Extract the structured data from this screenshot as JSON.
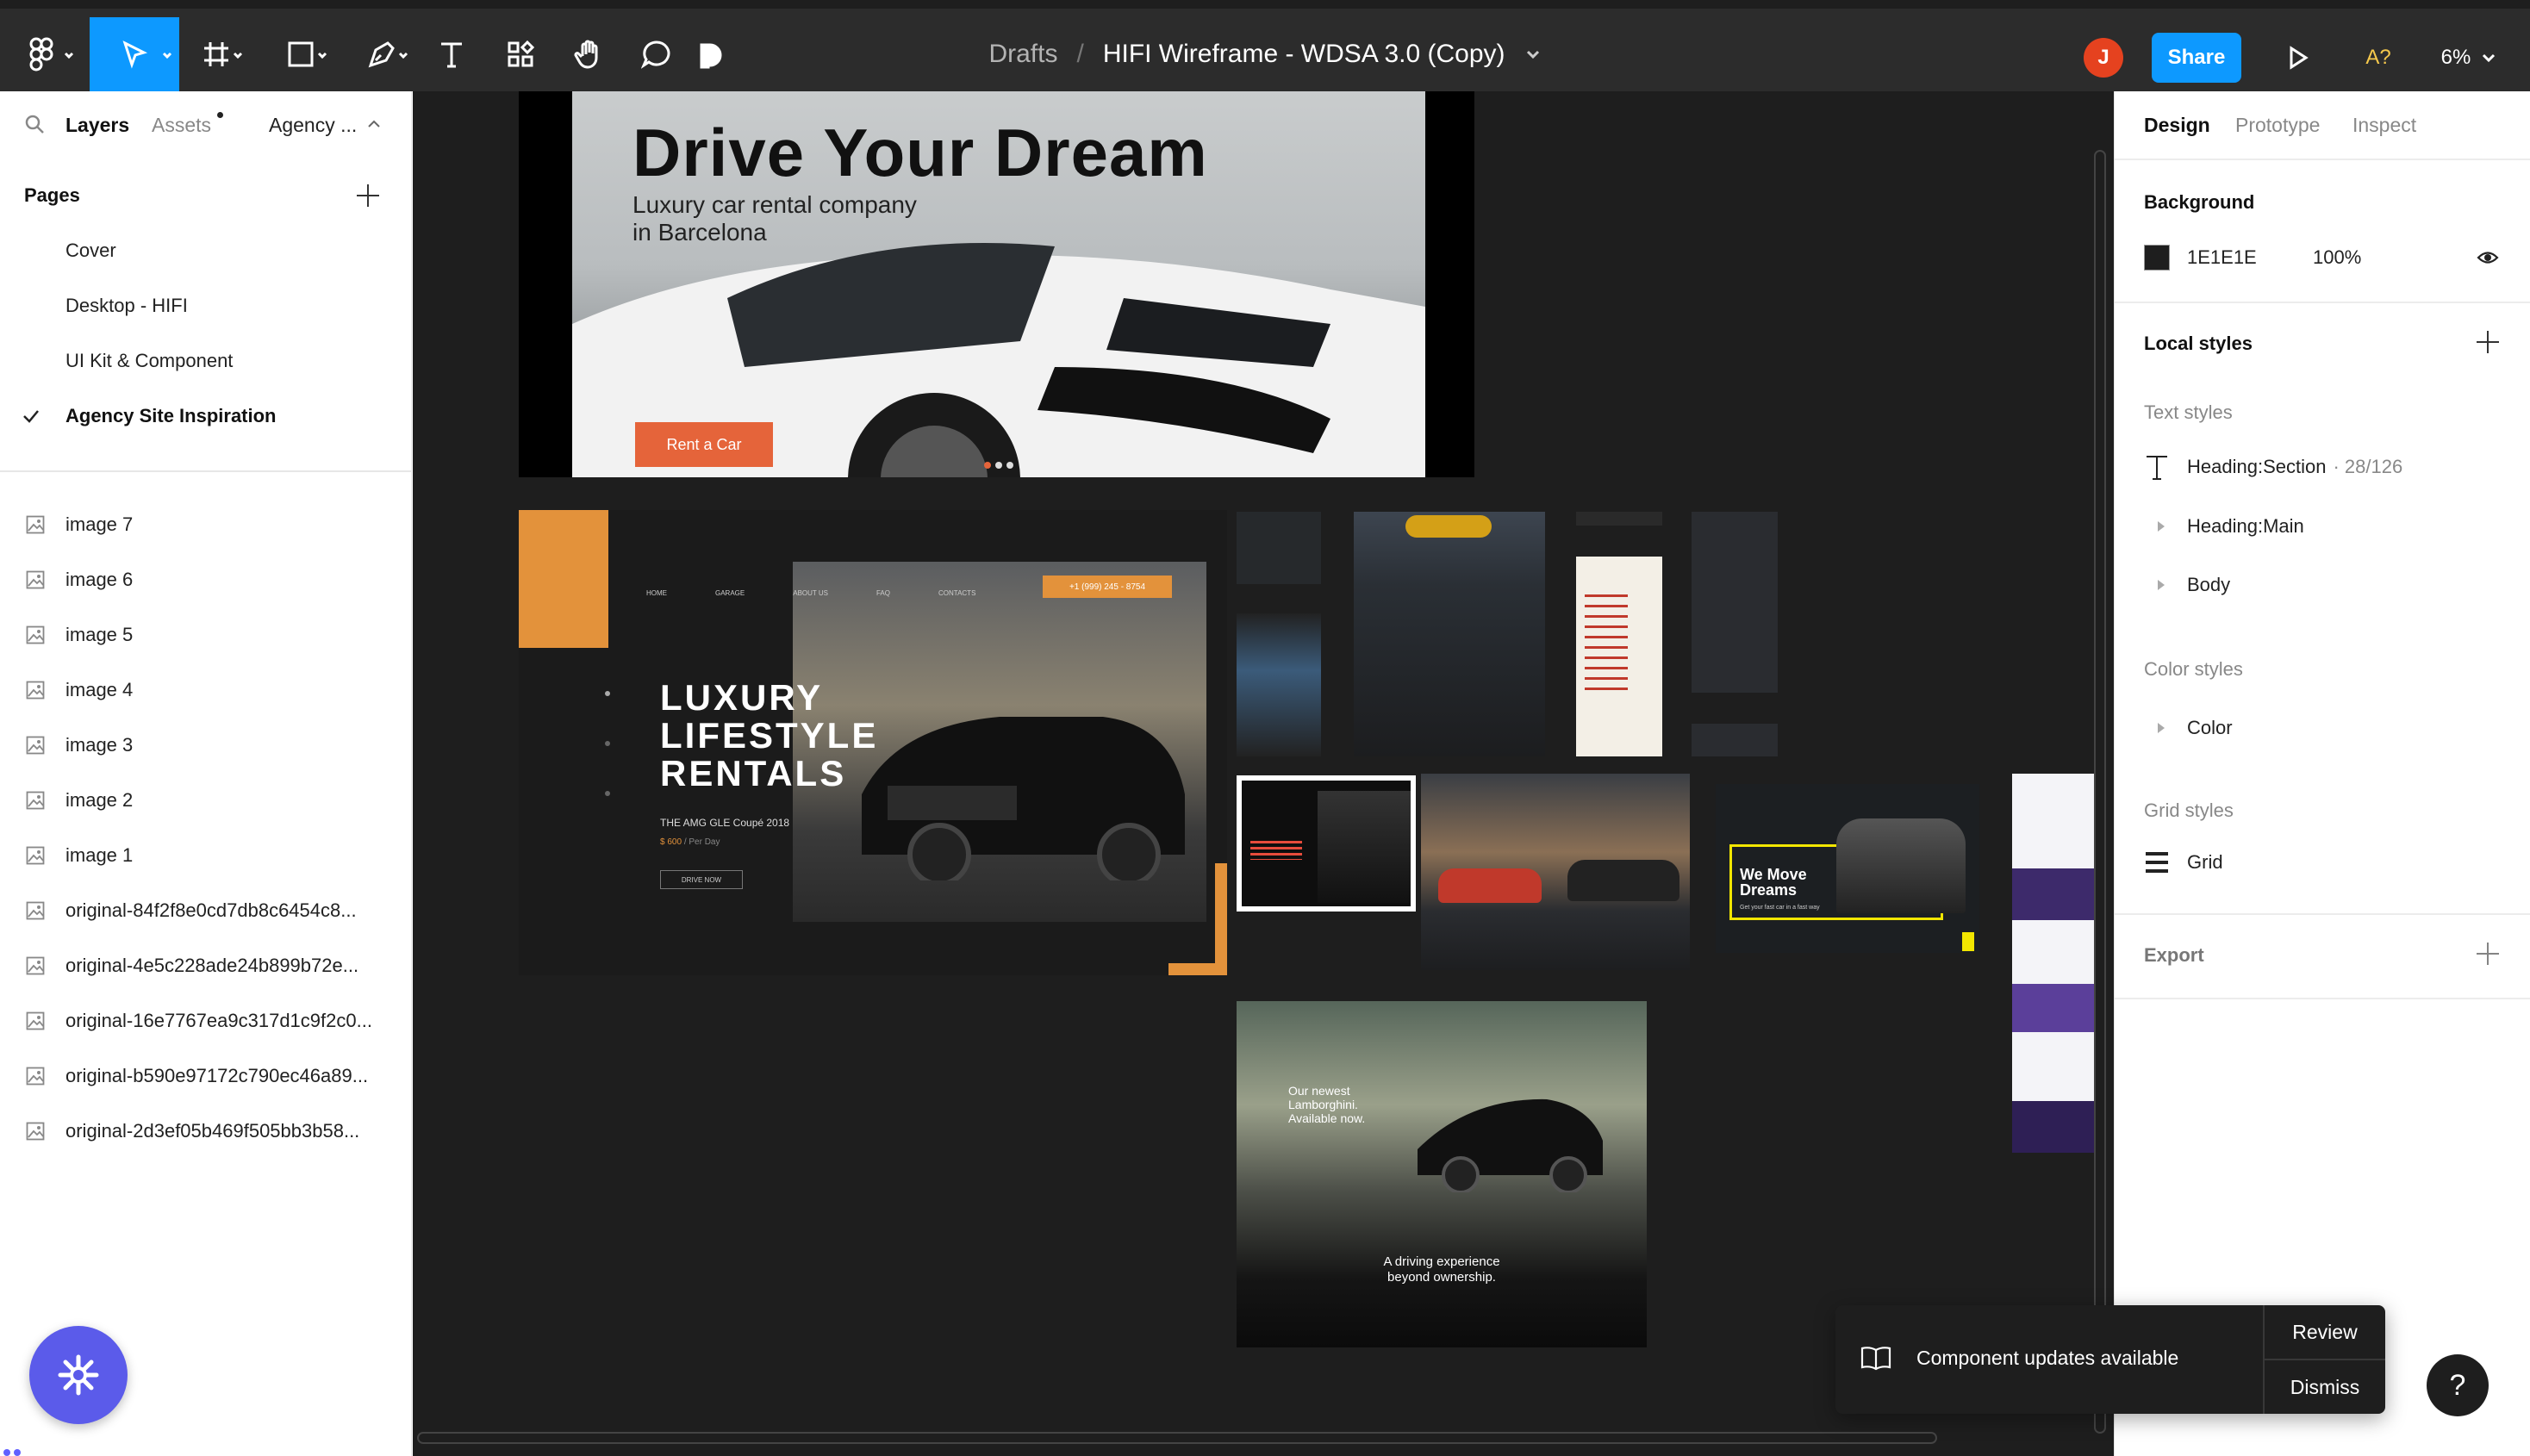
{
  "toolbar": {
    "breadcrumb": "Drafts",
    "separator": "/",
    "file_name": "HIFI Wireframe - WDSA 3.0 (Copy)",
    "avatar_initial": "J",
    "share_label": "Share",
    "font_warning": "A?",
    "zoom": "6%"
  },
  "left_panel": {
    "tabs": [
      "Layers",
      "Assets",
      "Agency ..."
    ],
    "pages_label": "Pages",
    "pages": [
      "Cover",
      "Desktop - HIFI",
      "UI Kit & Component",
      "Agency Site Inspiration"
    ],
    "current_page": "Agency Site Inspiration",
    "layers": [
      "image 7",
      "image 6",
      "image 5",
      "image 4",
      "image 3",
      "image 2",
      "image 1",
      "original-84f2f8e0cd7db8c6454c8...",
      "original-4e5c228ade24b899b72e...",
      "original-16e7767ea9c317d1c9f2c0...",
      "original-b590e97172c790ec46a89...",
      "original-2d3ef05b469f505bb3b58..."
    ]
  },
  "canvas": {
    "hero": {
      "title": "Drive Your Dream",
      "subtitle_line1": "Luxury car rental company",
      "subtitle_line2": "in Barcelona",
      "cta": "Rent a Car"
    },
    "luxury": {
      "line1": "LUXURY",
      "line2": "LIFESTYLE",
      "line3": "RENTALS",
      "car": "THE AMG GLE Coupé 2018",
      "price": "$ 600",
      "per": "/ Per Day",
      "button": "DRIVE NOW",
      "nav": [
        "HOME",
        "GARAGE",
        "ABOUT US",
        "FAQ",
        "CONTACTS"
      ],
      "phone": "+1 (999) 245 - 8754"
    },
    "move": {
      "line1": "We Move",
      "line2": "Dreams",
      "tag": "Get your fast car in a fast way"
    },
    "lambo": {
      "headline": "Our newest Lamborghini. Available now.",
      "tagline_line1": "A driving experience",
      "tagline_line2": "beyond ownership."
    }
  },
  "right_panel": {
    "tabs": [
      "Design",
      "Prototype",
      "Inspect"
    ],
    "background_label": "Background",
    "background_hex": "1E1E1E",
    "background_opacity": "100%",
    "background_color": "#1E1E1E",
    "local_styles_label": "Local styles",
    "text_styles_label": "Text styles",
    "text_styles": [
      {
        "name": "Heading:Section",
        "meta": "· 28/126"
      },
      {
        "name": "Heading:Main",
        "meta": ""
      },
      {
        "name": "Body",
        "meta": ""
      }
    ],
    "color_styles_label": "Color styles",
    "color_styles": [
      "Color"
    ],
    "grid_styles_label": "Grid styles",
    "grid_styles": [
      "Grid"
    ],
    "export_label": "Export"
  },
  "toast": {
    "message": "Component updates available",
    "review": "Review",
    "dismiss": "Dismiss"
  },
  "help_label": "?",
  "colors": {
    "accent": "#0d99ff",
    "avatar": "#e5421f",
    "canvas": "#1e1e1e",
    "orange": "#e3923b",
    "fab": "#5b5bea"
  }
}
